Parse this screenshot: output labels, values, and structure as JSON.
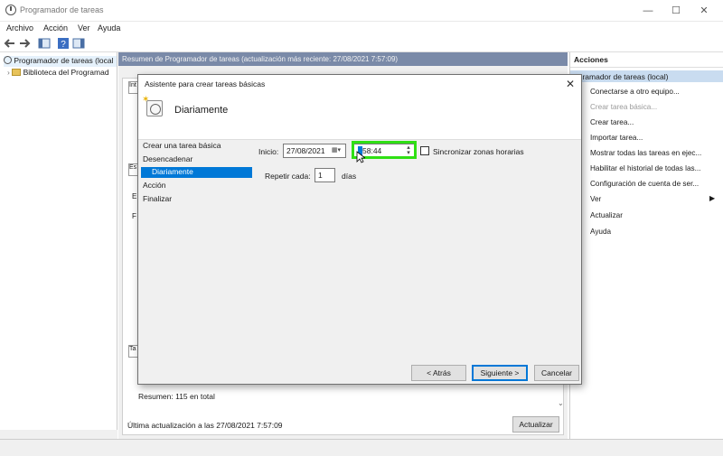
{
  "window": {
    "title": "Programador de tareas",
    "controls": {
      "minimize": "—",
      "maximize": "☐",
      "close": "✕"
    }
  },
  "menubar": {
    "items": [
      "Archivo",
      "Acción",
      "Ver",
      "Ayuda"
    ]
  },
  "tree": {
    "root": "Programador de tareas (local",
    "child": "Biblioteca del Programad"
  },
  "center": {
    "header": "Resumen de Programador de tareas (actualización más reciente: 27/08/2021 7:57:09)",
    "summary": "Resumen: 115 en total",
    "last_update": "Última actualización a las 27/08/2021 7:57:09",
    "update_button": "Actualizar",
    "hidden_tabs": [
      "Int",
      "Es",
      "E",
      "F",
      "Ta"
    ]
  },
  "actions": {
    "title": "Acciones",
    "group": "ogramador de tareas (local)",
    "items": [
      {
        "label": "Conectarse a otro equipo...",
        "disabled": false
      },
      {
        "label": "Crear tarea básica...",
        "disabled": true
      },
      {
        "label": "Crear tarea...",
        "disabled": false
      },
      {
        "label": "Importar tarea...",
        "disabled": false
      },
      {
        "label": "Mostrar todas las tareas en ejec...",
        "disabled": false
      },
      {
        "label": "Habilitar el historial de todas las...",
        "disabled": false
      },
      {
        "label": "Configuración de cuenta de ser...",
        "disabled": false
      },
      {
        "label": "Ver",
        "disabled": false
      },
      {
        "label": "Actualizar",
        "disabled": false
      },
      {
        "label": "Ayuda",
        "disabled": false
      }
    ]
  },
  "dialog": {
    "title": "Asistente para crear tareas básicas",
    "close": "✕",
    "header_title": "Diariamente",
    "steps": [
      "Crear una tarea básica",
      "Desencadenar",
      "Diariamente",
      "Acción",
      "Finalizar"
    ],
    "active_step_index": 2,
    "form": {
      "inicio_label": "Inicio:",
      "date_value": "27/08/2021",
      "time_value": "58:44",
      "sync_label": "Sincronizar zonas horarias",
      "sync_checked": false,
      "repeat_label": "Repetir cada:",
      "repeat_value": "1",
      "days_label": "días"
    },
    "buttons": {
      "back": "< Atrás",
      "next": "Siguiente >",
      "cancel": "Cancelar"
    }
  },
  "colors": {
    "highlight": "#2fe014",
    "selection": "#0078d7",
    "header_bar": "#7a8aa8",
    "actions_group": "#c9dcf0"
  }
}
